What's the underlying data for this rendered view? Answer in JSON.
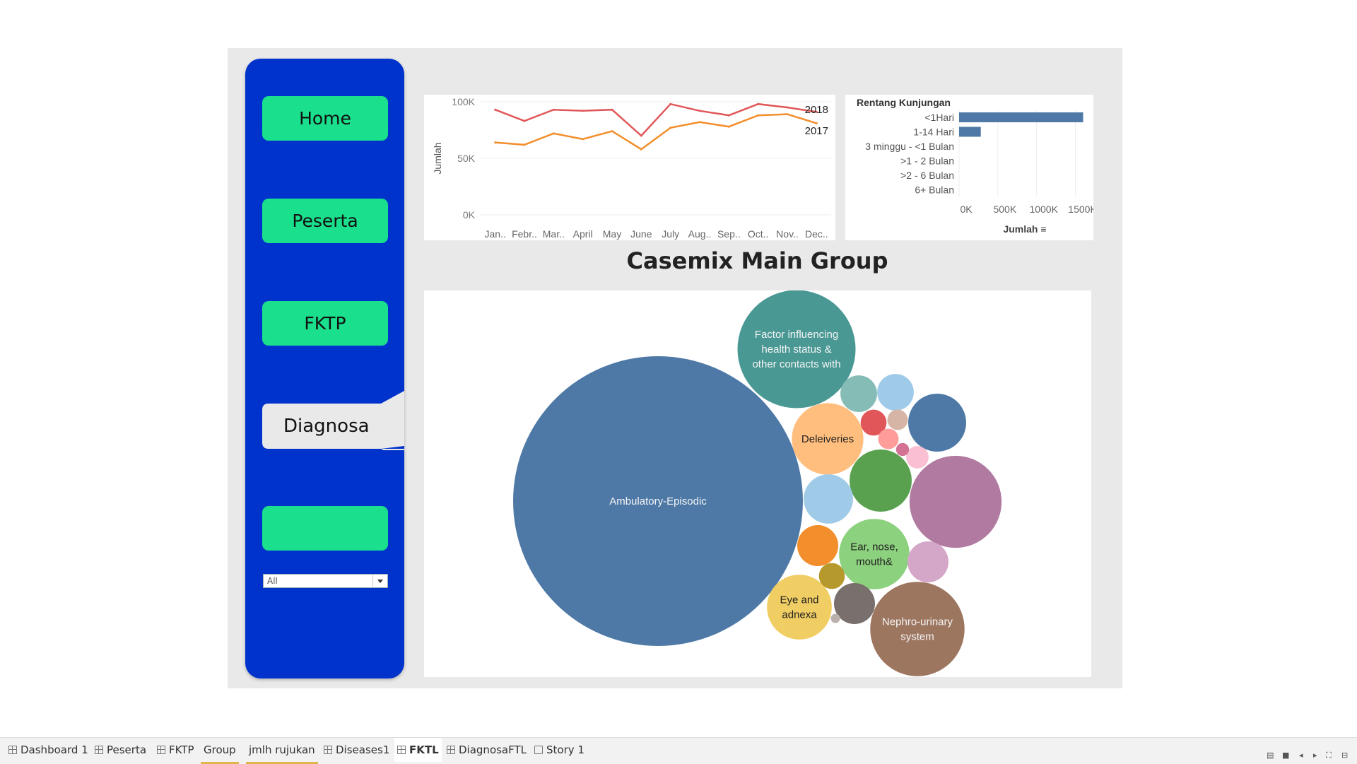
{
  "nav": {
    "home": "Home",
    "peserta": "Peserta",
    "fktp": "FKTP",
    "diagnosa": "Diagnosa",
    "blank": "",
    "filter_value": "All"
  },
  "colors": {
    "sidebar": "#0033cc",
    "nav_button": "#1adf8c",
    "line_2018": "#e15759",
    "line_2017": "#f28e2b",
    "bar": "#4e79a7"
  },
  "line_chart": {
    "ylabel": "Jumlah",
    "yticks": [
      "100K",
      "50K",
      "0K"
    ],
    "months": [
      "Jan..",
      "Febr..",
      "Mar..",
      "April",
      "May",
      "June",
      "July",
      "Aug..",
      "Sep..",
      "Oct..",
      "Nov..",
      "Dec.."
    ]
  },
  "bar_chart": {
    "header": "Rentang Kunjungan",
    "xticks": [
      "0K",
      "500K",
      "1000K",
      "1500K"
    ],
    "xlabel": "Jumlah"
  },
  "bubble": {
    "title": "Casemix Main Group"
  },
  "tabs": [
    "Dashboard 1",
    "Peserta",
    "FKTP",
    "Group",
    "jmlh rujukan",
    "Diseases1",
    "FKTL",
    "DiagnosaFTL",
    "Story 1"
  ],
  "chart_data": [
    {
      "type": "line",
      "x": [
        "Jan..",
        "Febr..",
        "Mar..",
        "April",
        "May",
        "June",
        "July",
        "Aug..",
        "Sep..",
        "Oct..",
        "Nov..",
        "Dec.."
      ],
      "series": [
        {
          "name": "2018",
          "values": [
            93000,
            83000,
            93000,
            92000,
            93000,
            70000,
            98000,
            92000,
            88000,
            98000,
            95000,
            91000
          ]
        },
        {
          "name": "2017",
          "values": [
            64000,
            62000,
            72000,
            67000,
            74000,
            58000,
            77000,
            82000,
            78000,
            88000,
            89000,
            81000
          ]
        }
      ],
      "ylabel": "Jumlah",
      "ylim": [
        0,
        100000
      ],
      "grid": true
    },
    {
      "type": "bar",
      "orientation": "horizontal",
      "categories": [
        "<1Hari",
        "1-14 Hari",
        "3 minggu - <1 Bulan",
        ">1 - 2 Bulan",
        ">2 - 6 Bulan",
        "6+ Bulan"
      ],
      "values": [
        1600000,
        280000,
        0,
        0,
        0,
        0
      ],
      "xlabel": "Jumlah",
      "xlim": [
        0,
        1650000
      ],
      "grid": true
    },
    {
      "type": "bubble",
      "title": "Casemix Main Group",
      "items": [
        {
          "label": "Ambulatory-Episodic",
          "value": 1000,
          "color": "#4e79a7"
        },
        {
          "label": "Factor influencing health status & other contacts with",
          "value": 166,
          "color": "#499894"
        },
        {
          "label": "Deleiveries",
          "value": 61,
          "color": "#ffbe7d"
        },
        {
          "label": "Ear, nose, mouth&",
          "value": 59,
          "color": "#8cd17d"
        },
        {
          "label": "Eye and adnexa",
          "value": 50,
          "color": "#f1ce63"
        },
        {
          "label": "Nephro-urinary system",
          "value": 106,
          "color": "#9d7660"
        },
        {
          "label": "",
          "value": 101,
          "color": "#b07aa1"
        },
        {
          "label": "",
          "value": 40,
          "color": "#4e79a7"
        },
        {
          "label": "",
          "value": 46,
          "color": "#59a14f"
        },
        {
          "label": "",
          "value": 29,
          "color": "#a0cbe8"
        },
        {
          "label": "",
          "value": 20,
          "color": "#d4a6c8"
        },
        {
          "label": "",
          "value": 20,
          "color": "#79706e"
        },
        {
          "label": "",
          "value": 20,
          "color": "#f28e2b"
        },
        {
          "label": "",
          "value": 16,
          "color": "#86bcb6"
        },
        {
          "label": "",
          "value": 16,
          "color": "#a0cbe8"
        },
        {
          "label": "",
          "value": 8,
          "color": "#e15759"
        },
        {
          "label": "",
          "value": 5,
          "color": "#d7b5a6"
        },
        {
          "label": "",
          "value": 5,
          "color": "#ff9d9a"
        },
        {
          "label": "",
          "value": 6,
          "color": "#fabfd2"
        },
        {
          "label": "",
          "value": 8,
          "color": "#b6992d"
        },
        {
          "label": "",
          "value": 2,
          "color": "#d37295"
        },
        {
          "label": "",
          "value": 1,
          "color": "#bab0ac"
        }
      ]
    }
  ]
}
